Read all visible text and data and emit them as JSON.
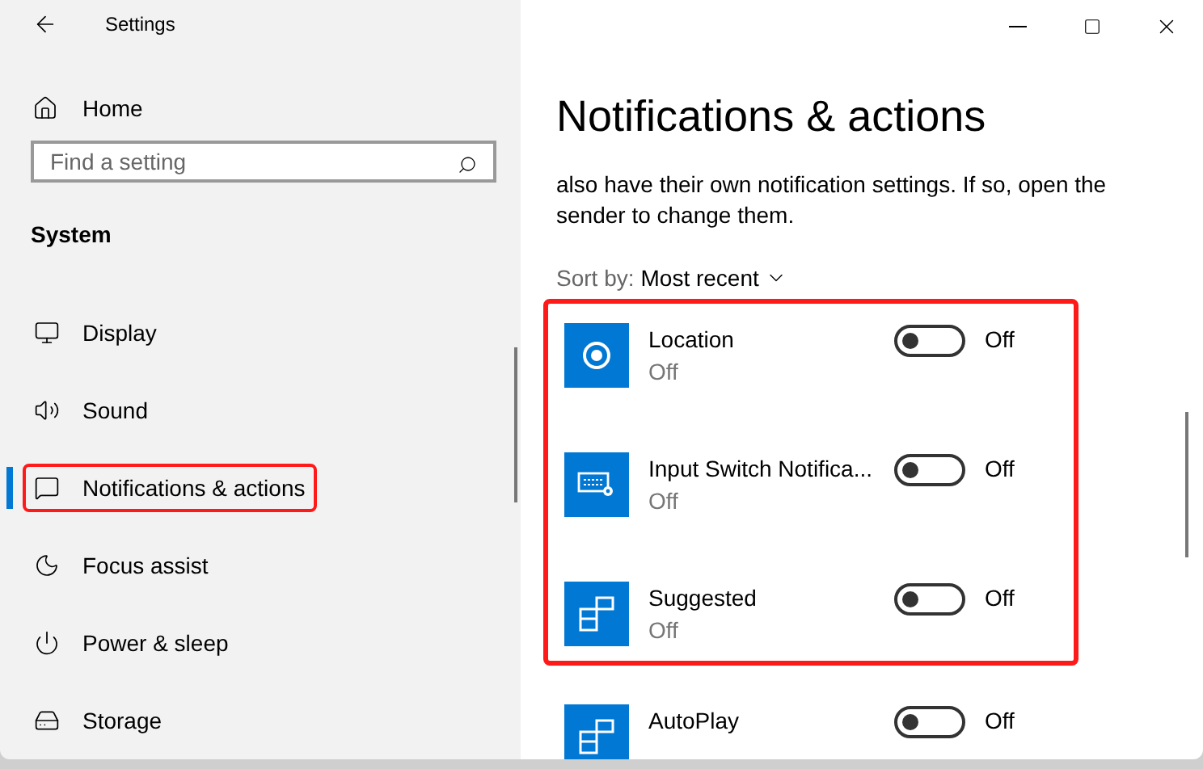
{
  "window": {
    "title": "Settings"
  },
  "sidebar": {
    "home": "Home",
    "search": {
      "placeholder": "Find a setting"
    },
    "section": "System",
    "items": [
      {
        "label": "Display",
        "selected": false,
        "highlighted": false
      },
      {
        "label": "Sound",
        "selected": false,
        "highlighted": false
      },
      {
        "label": "Notifications & actions",
        "selected": true,
        "highlighted": true
      },
      {
        "label": "Focus assist",
        "selected": false,
        "highlighted": false
      },
      {
        "label": "Power & sleep",
        "selected": false,
        "highlighted": false
      },
      {
        "label": "Storage",
        "selected": false,
        "highlighted": false
      }
    ]
  },
  "content": {
    "heading": "Notifications & actions",
    "description": "also have their own notification settings. If so, open the sender to change them.",
    "sort": {
      "label": "Sort by:",
      "value": "Most recent"
    },
    "apps": [
      {
        "name": "Location",
        "status": "Off",
        "kind": "location",
        "on": false,
        "toggle_label": "Off",
        "highlighted": true
      },
      {
        "name": "Input Switch Notifica...",
        "status": "Off",
        "kind": "keyboard",
        "on": false,
        "toggle_label": "Off",
        "highlighted": true
      },
      {
        "name": "Suggested",
        "status": "Off",
        "kind": "tiles",
        "on": false,
        "toggle_label": "Off",
        "highlighted": true
      },
      {
        "name": "AutoPlay",
        "kind": "tiles",
        "on": false,
        "toggle_label": "Off",
        "highlighted": false
      }
    ]
  }
}
